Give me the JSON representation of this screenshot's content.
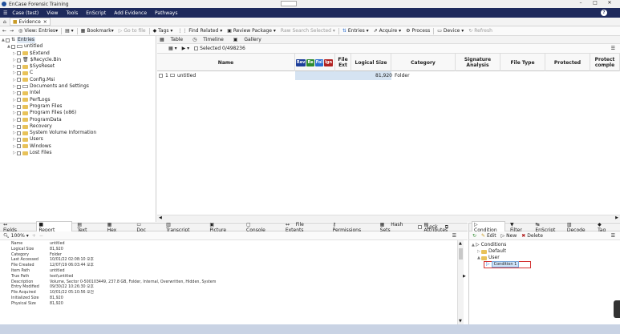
{
  "window": {
    "title": "EnCase Forensic Training",
    "controls": [
      "–",
      "□",
      "✕"
    ]
  },
  "menu": [
    {
      "label": "Case (test)"
    },
    {
      "label": "View"
    },
    {
      "label": "Tools"
    },
    {
      "label": "EnScript"
    },
    {
      "label": "Add Evidence"
    },
    {
      "label": "Pathways"
    }
  ],
  "tab": {
    "label": "Evidence"
  },
  "toolbar": {
    "view_entries": "View: Entries",
    "bookmark": "Bookmark",
    "goto_file": "Go to file",
    "tags": "Tags",
    "find_related": "Find Related",
    "review_package": "Review Package",
    "raw_search": "Raw Search Selected",
    "entries": "Entries",
    "acquire": "Acquire",
    "process": "Process",
    "device": "Device",
    "refresh": "Refresh"
  },
  "tree": {
    "root": "Entries",
    "items": [
      {
        "label": "untitled",
        "indent": 1
      },
      {
        "label": "$Extend",
        "indent": 2
      },
      {
        "label": "$Recycle.Bin",
        "indent": 2
      },
      {
        "label": "$SysReset",
        "indent": 2
      },
      {
        "label": "C",
        "indent": 2
      },
      {
        "label": "Config.Msi",
        "indent": 2
      },
      {
        "label": "Documents and Settings",
        "indent": 2
      },
      {
        "label": "Intel",
        "indent": 2
      },
      {
        "label": "PerfLogs",
        "indent": 2
      },
      {
        "label": "Program Files",
        "indent": 2
      },
      {
        "label": "Program Files (x86)",
        "indent": 2
      },
      {
        "label": "ProgramData",
        "indent": 2
      },
      {
        "label": "Recovery",
        "indent": 2
      },
      {
        "label": "System Volume Information",
        "indent": 2
      },
      {
        "label": "Users",
        "indent": 2
      },
      {
        "label": "Windows",
        "indent": 2
      },
      {
        "label": "Lost Files",
        "indent": 2
      }
    ]
  },
  "viewtabs": [
    {
      "label": "Table"
    },
    {
      "label": "Timeline"
    },
    {
      "label": "Gallery"
    }
  ],
  "selected": "Selected 0/498236",
  "columns": {
    "name": "Name",
    "badges": [
      {
        "t": "Rev",
        "c": "#1d3f9a"
      },
      {
        "t": "Re",
        "c": "#2e8b2e"
      },
      {
        "t": "Fol",
        "c": "#2b6fd1"
      },
      {
        "t": "Ign",
        "c": "#b22222"
      }
    ],
    "ext": "File Ext",
    "size": "Logical Size",
    "category": "Category",
    "sig": "Signature Analysis",
    "type": "File Type",
    "protected": "Protected",
    "protcomp": "Protect comple"
  },
  "row": {
    "num": "1",
    "name": "untitled",
    "size": "81,920",
    "category": "Folder"
  },
  "lowtabs": [
    {
      "label": "Fields"
    },
    {
      "label": "Report"
    },
    {
      "label": "Text"
    },
    {
      "label": "Hex"
    },
    {
      "label": "Doc"
    },
    {
      "label": "Transcript"
    },
    {
      "label": "Picture"
    },
    {
      "label": "Console"
    },
    {
      "label": "File Extents"
    },
    {
      "label": "Permissions"
    },
    {
      "label": "Hash Sets"
    },
    {
      "label": "Attributes"
    }
  ],
  "lock": "Lock",
  "zoom": "100%",
  "report": [
    {
      "k": "Name",
      "v": "untitled"
    },
    {
      "k": "Logical Size",
      "v": "81,920"
    },
    {
      "k": "Category",
      "v": "Folder"
    },
    {
      "k": "Last Accessed",
      "v": "10/01/22 02:08:10 오후"
    },
    {
      "k": "File Created",
      "v": "12/07/19 06:03:44 오후"
    },
    {
      "k": "Item Path",
      "v": "untitled"
    },
    {
      "k": "True Path",
      "v": "test\\untitled"
    },
    {
      "k": "Description",
      "v": "Volume, Sector 0-500103449, 237.8 GB, Folder, Internal, Overwritten, Hidden, System"
    },
    {
      "k": "Entry Modified",
      "v": "09/30/22 10:26:30 오후"
    },
    {
      "k": "File Acquired",
      "v": "10/01/22 05:10:56 오전"
    },
    {
      "k": "Initialized Size",
      "v": "81,920"
    },
    {
      "k": "Physical Size",
      "v": "81,920"
    }
  ],
  "condtabs": [
    {
      "label": "Condition"
    },
    {
      "label": "Filter"
    },
    {
      "label": "EnScript"
    },
    {
      "label": "Decode"
    },
    {
      "label": "Tag"
    }
  ],
  "condbar": {
    "edit": "Edit",
    "new": "New",
    "delete": "Delete"
  },
  "condtree": {
    "root": "Conditions",
    "default": "Default",
    "user": "User",
    "cond1": "Condition 1"
  }
}
